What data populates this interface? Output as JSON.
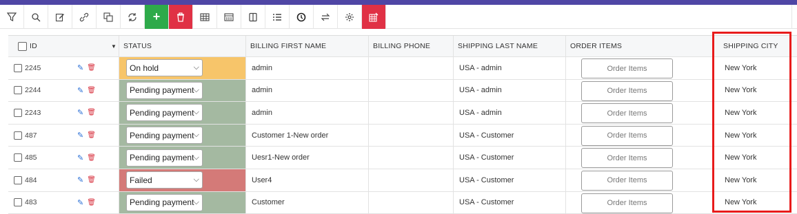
{
  "toolbar": {
    "icons": [
      "filter-icon",
      "search-icon",
      "edit-icon",
      "link-icon",
      "duplicate-icon",
      "refresh-icon",
      "add-icon",
      "delete-icon",
      "table-icon",
      "columns-icon",
      "panel-icon",
      "list-icon",
      "history-icon",
      "swap-icon",
      "settings-icon",
      "bulk-edit-icon"
    ],
    "add_label": "+"
  },
  "table": {
    "headers": {
      "id": "ID",
      "status": "STATUS",
      "billing_first_name": "BILLING FIRST NAME",
      "billing_phone": "BILLING PHONE",
      "shipping_last_name": "SHIPPING LAST NAME",
      "order_items": "ORDER ITEMS",
      "shipping_city": "SHIPPING CITY"
    },
    "rows": [
      {
        "id": "2245",
        "status": "On hold",
        "status_color": "#f7c56a",
        "billing_first_name": "admin",
        "billing_phone": "",
        "shipping_last_name": "USA - admin",
        "order_items": "Order Items",
        "shipping_city": "New York"
      },
      {
        "id": "2244",
        "status": "Pending payment",
        "status_color": "#a4b9a1",
        "billing_first_name": "admin",
        "billing_phone": "",
        "shipping_last_name": "USA - admin",
        "order_items": "Order Items",
        "shipping_city": "New York"
      },
      {
        "id": "2243",
        "status": "Pending payment",
        "status_color": "#a4b9a1",
        "billing_first_name": "admin",
        "billing_phone": "",
        "shipping_last_name": "USA - admin",
        "order_items": "Order Items",
        "shipping_city": "New York"
      },
      {
        "id": "487",
        "status": "Pending payment",
        "status_color": "#a4b9a1",
        "billing_first_name": "Customer 1-New order",
        "billing_phone": "",
        "shipping_last_name": "USA - Customer",
        "order_items": "Order Items",
        "shipping_city": "New York"
      },
      {
        "id": "485",
        "status": "Pending payment",
        "status_color": "#a4b9a1",
        "billing_first_name": "Uesr1-New order",
        "billing_phone": "",
        "shipping_last_name": "USA - Customer",
        "order_items": "Order Items",
        "shipping_city": "New York"
      },
      {
        "id": "484",
        "status": "Failed",
        "status_color": "#d47a78",
        "billing_first_name": "User4",
        "billing_phone": "",
        "shipping_last_name": "USA - Customer",
        "order_items": "Order Items",
        "shipping_city": "New York"
      },
      {
        "id": "483",
        "status": "Pending payment",
        "status_color": "#a4b9a1",
        "billing_first_name": "Customer",
        "billing_phone": "",
        "shipping_last_name": "USA - Customer",
        "order_items": "Order Items",
        "shipping_city": "New York"
      }
    ]
  },
  "colors": {
    "accent_bar": "#4f46a5",
    "add_button": "#2eaa4a",
    "delete_button": "#e03145",
    "highlight_box": "#e81b1b"
  }
}
